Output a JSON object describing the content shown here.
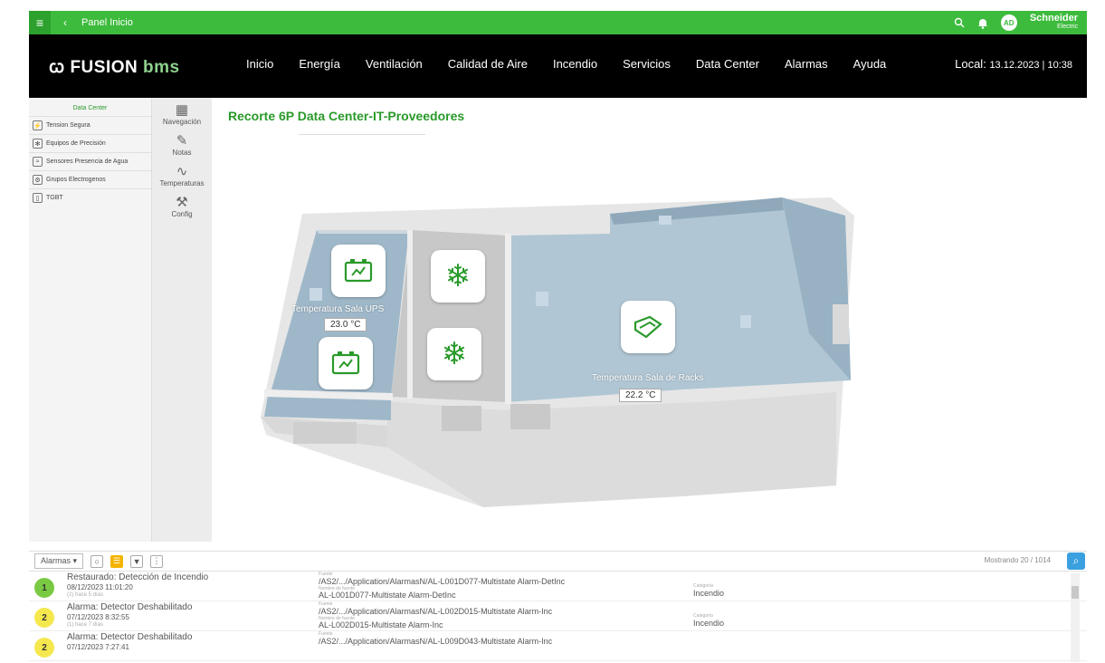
{
  "topbar": {
    "menu_icon": "≡",
    "back_icon": "‹",
    "title": "Panel Inicio",
    "avatar": "AD",
    "brand": "Schneider",
    "brand_sub": "Electric"
  },
  "navbar": {
    "logo_a": "ꞷ FUSION ",
    "logo_b": "bms",
    "items": [
      "Inicio",
      "Energía",
      "Ventilación",
      "Calidad de Aire",
      "Incendio",
      "Servicios",
      "Data Center",
      "Alarmas",
      "Ayuda"
    ],
    "local_label": "Local:",
    "local_value": "13.12.2023 | 10:38"
  },
  "sidebar": {
    "head": "Data Center",
    "items": [
      {
        "label": "Tension Segura",
        "icon": "bolt-icon"
      },
      {
        "label": "Equipos de Precisión",
        "icon": "snowflake-icon"
      },
      {
        "label": "Sensores Presencia de Agua",
        "icon": "water-icon"
      },
      {
        "label": "Grupos Electrogenos",
        "icon": "generator-icon"
      },
      {
        "label": "TGBT",
        "icon": "panel-icon"
      }
    ]
  },
  "tools": [
    {
      "label": "Navegación",
      "glyph": "▦"
    },
    {
      "label": "Notas",
      "glyph": "✎"
    },
    {
      "label": "Temperaturas",
      "glyph": "∿"
    },
    {
      "label": "Config",
      "glyph": "⚒"
    }
  ],
  "main": {
    "title": "Recorte 6P Data Center-IT-Proveedores",
    "ups_label": "Temperatura Sala  UPS",
    "ups_value": "23.0 °C",
    "racks_label": "Temperatura Sala de Racks",
    "racks_value": "22.2 °C"
  },
  "alarms": {
    "dropdown": "Alarmas ▾",
    "showing": "Mostrando 20 / 1014",
    "labels": {
      "source": "Fuente",
      "source_name": "Nombre de fuente",
      "category": "Categoría"
    },
    "rows": [
      {
        "priority": "1",
        "color": "#7ac943",
        "title": "Restaurado: Detección de Incendio",
        "date": "08/12/2023 11:01:20",
        "ago": "(2) hace 5 días",
        "source": "/AS2/.../Application/AlarmasN/AL-L001D077-Multistate Alarm-DetInc",
        "name": "AL-L001D077-Multistate Alarm-DetInc",
        "category": "Incendio"
      },
      {
        "priority": "2",
        "color": "#f4e84e",
        "title": "Alarma: Detector Deshabilitado",
        "date": "07/12/2023 8:32:55",
        "ago": "(1) hace 7 días",
        "source": "/AS2/.../Application/AlarmasN/AL-L002D015-Multistate Alarm-Inc",
        "name": "AL-L002D015-Multistate Alarm-Inc",
        "category": "Incendio"
      },
      {
        "priority": "2",
        "color": "#f4e84e",
        "title": "Alarma: Detector Deshabilitado",
        "date": "07/12/2023 7:27:41",
        "ago": "",
        "source": "/AS2/.../Application/AlarmasN/AL-L009D043-Multistate Alarm-Inc",
        "name": "",
        "category": ""
      }
    ]
  }
}
